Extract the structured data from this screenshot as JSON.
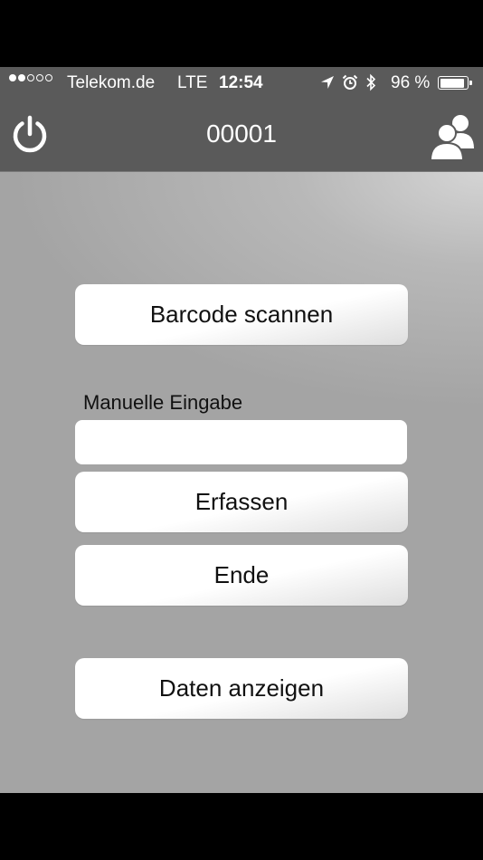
{
  "status_bar": {
    "signal_filled": 2,
    "signal_total": 5,
    "carrier": "Telekom.de",
    "network": "LTE",
    "time": "12:54",
    "icons": [
      "location-arrow-icon",
      "alarm-clock-icon",
      "bluetooth-icon"
    ],
    "battery_percent_text": "96 %",
    "battery_level": 0.96
  },
  "nav_bar": {
    "title": "00001",
    "left_icon": "power-icon",
    "right_icon": "users-icon"
  },
  "main": {
    "scan_button_label": "Barcode scannen",
    "manual_label": "Manuelle Eingabe",
    "manual_input_value": "",
    "manual_input_placeholder": "",
    "capture_button_label": "Erfassen",
    "end_button_label": "Ende",
    "show_data_button_label": "Daten anzeigen"
  },
  "colors": {
    "bar_background": "#5a5a5a",
    "content_background": "#b8b8b8",
    "button_background": "#ffffff",
    "text_dark": "#111111",
    "text_light": "#ffffff"
  }
}
